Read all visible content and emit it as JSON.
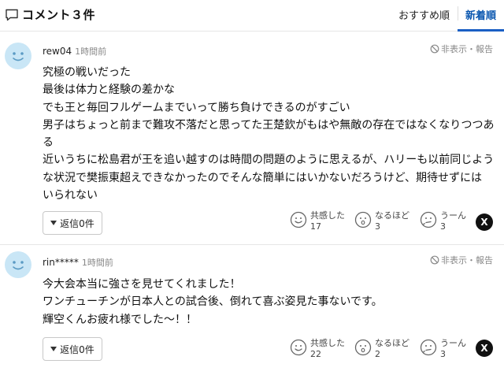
{
  "header": {
    "title": "コメント３件",
    "sort_recommended": "おすすめ順",
    "sort_newest": "新着順"
  },
  "comments": [
    {
      "user": "rew04",
      "time": "1時間前",
      "report": "非表示・報告",
      "body": "究極の戦いだった\n最後は体力と経験の差かな\nでも王と毎回フルゲームまでいって勝ち負けできるのがすごい\n男子はちょっと前まで難攻不落だと思ってた王楚欽がもはや無敵の存在ではなくなりつつあ\nる\n近いうちに松島君が王を追い越すのは時間の問題のように思えるが、ハリーも以前同じよう\nな状況で樊振東超えできなかったのでそんな簡単にはいかないだろうけど、期待せずには\nいられない",
      "reply": "返信0件",
      "reactions": [
        {
          "label": "共感した",
          "count": "17"
        },
        {
          "label": "なるほど",
          "count": "3"
        },
        {
          "label": "うーん",
          "count": "3"
        }
      ],
      "x_label": "X"
    },
    {
      "user": "rin*****",
      "time": "1時間前",
      "report": "非表示・報告",
      "body": "今大会本当に強さを見せてくれました！\nワンチューチンが日本人との試合後、倒れて喜ぶ姿見た事ないです。\n輝空くんお疲れ様でした〜！！",
      "reply": "返信0件",
      "reactions": [
        {
          "label": "共感した",
          "count": "22"
        },
        {
          "label": "なるほど",
          "count": "2"
        },
        {
          "label": "うーん",
          "count": "3"
        }
      ],
      "x_label": "X"
    }
  ],
  "colors": {
    "accent": "#0b57b0",
    "avatar": "#c9e6f6",
    "avatar_face": "#5b9bc4"
  }
}
